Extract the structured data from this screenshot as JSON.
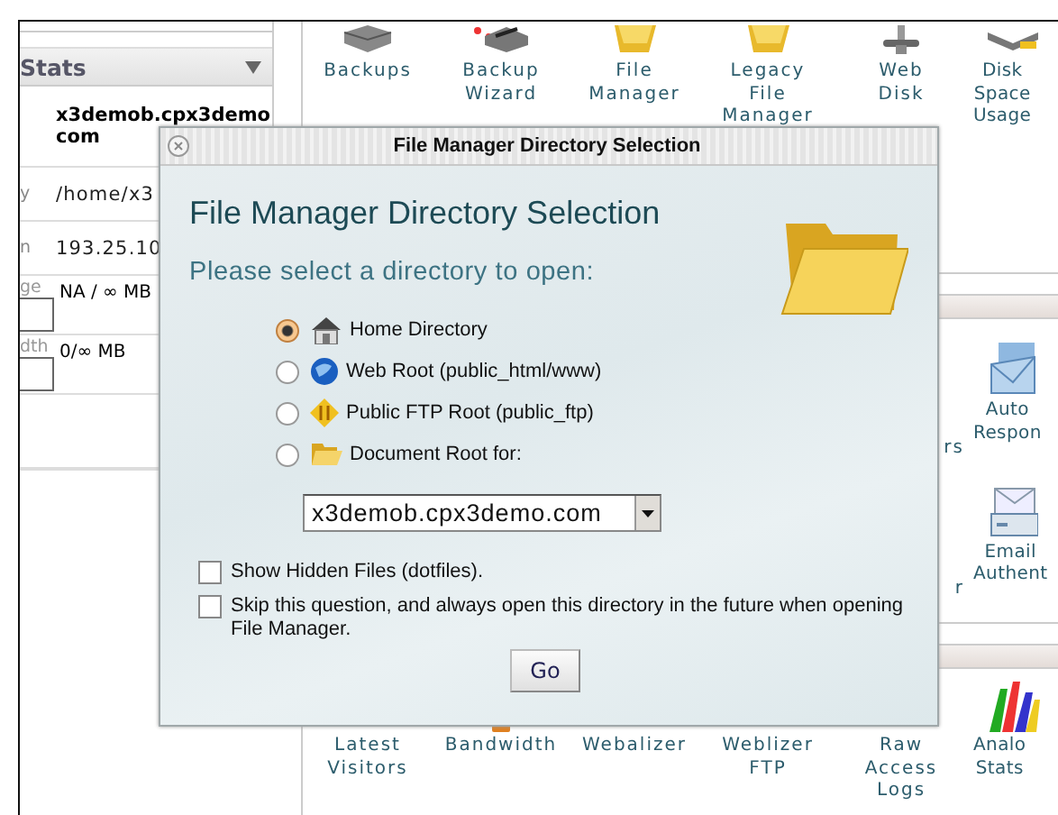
{
  "sidebar": {
    "header": "Stats",
    "domain_lines": [
      "x3demob.cpx3demo",
      "com"
    ],
    "rows": [
      {
        "kind": "text",
        "label": "y",
        "value": "/home/x3"
      },
      {
        "kind": "text",
        "label": "n",
        "value": "193.25.10"
      },
      {
        "kind": "gauge",
        "label": "ge",
        "value": "NA / ∞ MB"
      },
      {
        "kind": "gauge",
        "label": "dth",
        "value": "0/∞ MB"
      }
    ]
  },
  "top_icons": [
    {
      "label": "Backups"
    },
    {
      "label": "Backup Wizard"
    },
    {
      "label": "File Manager"
    },
    {
      "label": "Legacy File Manager"
    },
    {
      "label": "Web Disk"
    },
    {
      "label": "Disk Space Usage"
    }
  ],
  "middle_fragments": [
    "rs",
    "r"
  ],
  "middle_icons": [
    {
      "label": "Auto Respon"
    },
    {
      "label": "Email Authent"
    }
  ],
  "bottom_icons": [
    {
      "label": "Latest Visitors"
    },
    {
      "label": "Bandwidth"
    },
    {
      "label": "Webalizer"
    },
    {
      "label": "Weblizer FTP"
    },
    {
      "label": "Raw Access Logs"
    },
    {
      "label": "Analo Stats"
    }
  ],
  "dialog": {
    "title": "File Manager Directory Selection",
    "heading": "File Manager Directory Selection",
    "prompt": "Please select a directory to open:",
    "options": [
      {
        "label": "Home Directory",
        "selected": true
      },
      {
        "label": "Web Root (public_html/www)",
        "selected": false
      },
      {
        "label": "Public FTP Root (public_ftp)",
        "selected": false
      },
      {
        "label": "Document Root for:",
        "selected": false,
        "select": {
          "value": "x3demob.cpx3demo.com"
        }
      }
    ],
    "checkboxes": [
      {
        "label": "Show Hidden Files (dotfiles).",
        "checked": false
      },
      {
        "label": "Skip this question, and always open this directory in the future when opening File Manager.",
        "checked": false
      }
    ],
    "button": "Go"
  }
}
